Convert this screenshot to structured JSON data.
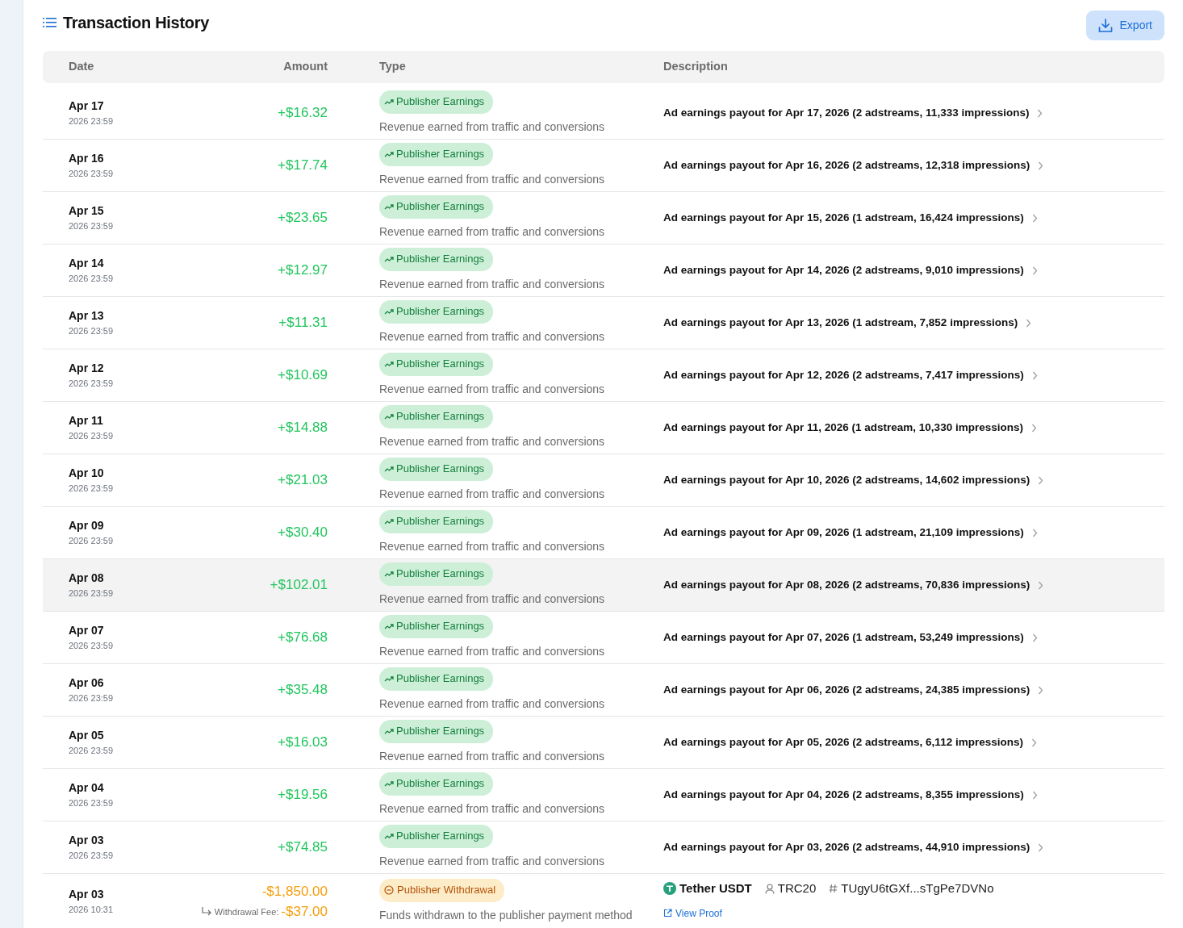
{
  "title": "Transaction History",
  "export_button": "Export",
  "columns": [
    "Date",
    "Amount",
    "Type",
    "Description"
  ],
  "rows": [
    {
      "kind": "earning",
      "highlighted": false,
      "date": "Apr 17",
      "time": "2026 23:59",
      "amount": "+$16.32",
      "type": "Publisher Earnings",
      "type_note": "Revenue earned from traffic and conversions",
      "description": "Ad earnings payout for Apr 17, 2026 (2 adstreams, 11,333 impressions)"
    },
    {
      "kind": "earning",
      "highlighted": false,
      "date": "Apr 16",
      "time": "2026 23:59",
      "amount": "+$17.74",
      "type": "Publisher Earnings",
      "type_note": "Revenue earned from traffic and conversions",
      "description": "Ad earnings payout for Apr 16, 2026 (2 adstreams, 12,318 impressions)"
    },
    {
      "kind": "earning",
      "highlighted": false,
      "date": "Apr 15",
      "time": "2026 23:59",
      "amount": "+$23.65",
      "type": "Publisher Earnings",
      "type_note": "Revenue earned from traffic and conversions",
      "description": "Ad earnings payout for Apr 15, 2026 (1 adstream, 16,424 impressions)"
    },
    {
      "kind": "earning",
      "highlighted": false,
      "date": "Apr 14",
      "time": "2026 23:59",
      "amount": "+$12.97",
      "type": "Publisher Earnings",
      "type_note": "Revenue earned from traffic and conversions",
      "description": "Ad earnings payout for Apr 14, 2026 (2 adstreams, 9,010 impressions)"
    },
    {
      "kind": "earning",
      "highlighted": false,
      "date": "Apr 13",
      "time": "2026 23:59",
      "amount": "+$11.31",
      "type": "Publisher Earnings",
      "type_note": "Revenue earned from traffic and conversions",
      "description": "Ad earnings payout for Apr 13, 2026 (1 adstream, 7,852 impressions)"
    },
    {
      "kind": "earning",
      "highlighted": false,
      "date": "Apr 12",
      "time": "2026 23:59",
      "amount": "+$10.69",
      "type": "Publisher Earnings",
      "type_note": "Revenue earned from traffic and conversions",
      "description": "Ad earnings payout for Apr 12, 2026 (2 adstreams, 7,417 impressions)"
    },
    {
      "kind": "earning",
      "highlighted": false,
      "date": "Apr 11",
      "time": "2026 23:59",
      "amount": "+$14.88",
      "type": "Publisher Earnings",
      "type_note": "Revenue earned from traffic and conversions",
      "description": "Ad earnings payout for Apr 11, 2026 (1 adstream, 10,330 impressions)"
    },
    {
      "kind": "earning",
      "highlighted": false,
      "date": "Apr 10",
      "time": "2026 23:59",
      "amount": "+$21.03",
      "type": "Publisher Earnings",
      "type_note": "Revenue earned from traffic and conversions",
      "description": "Ad earnings payout for Apr 10, 2026 (2 adstreams, 14,602 impressions)"
    },
    {
      "kind": "earning",
      "highlighted": false,
      "date": "Apr 09",
      "time": "2026 23:59",
      "amount": "+$30.40",
      "type": "Publisher Earnings",
      "type_note": "Revenue earned from traffic and conversions",
      "description": "Ad earnings payout for Apr 09, 2026 (1 adstream, 21,109 impressions)"
    },
    {
      "kind": "earning",
      "highlighted": true,
      "date": "Apr 08",
      "time": "2026 23:59",
      "amount": "+$102.01",
      "type": "Publisher Earnings",
      "type_note": "Revenue earned from traffic and conversions",
      "description": "Ad earnings payout for Apr 08, 2026 (2 adstreams, 70,836 impressions)"
    },
    {
      "kind": "earning",
      "highlighted": false,
      "date": "Apr 07",
      "time": "2026 23:59",
      "amount": "+$76.68",
      "type": "Publisher Earnings",
      "type_note": "Revenue earned from traffic and conversions",
      "description": "Ad earnings payout for Apr 07, 2026 (1 adstream, 53,249 impressions)"
    },
    {
      "kind": "earning",
      "highlighted": false,
      "date": "Apr 06",
      "time": "2026 23:59",
      "amount": "+$35.48",
      "type": "Publisher Earnings",
      "type_note": "Revenue earned from traffic and conversions",
      "description": "Ad earnings payout for Apr 06, 2026 (2 adstreams, 24,385 impressions)"
    },
    {
      "kind": "earning",
      "highlighted": false,
      "date": "Apr 05",
      "time": "2026 23:59",
      "amount": "+$16.03",
      "type": "Publisher Earnings",
      "type_note": "Revenue earned from traffic and conversions",
      "description": "Ad earnings payout for Apr 05, 2026 (2 adstreams, 6,112 impressions)"
    },
    {
      "kind": "earning",
      "highlighted": false,
      "date": "Apr 04",
      "time": "2026 23:59",
      "amount": "+$19.56",
      "type": "Publisher Earnings",
      "type_note": "Revenue earned from traffic and conversions",
      "description": "Ad earnings payout for Apr 04, 2026 (2 adstreams, 8,355 impressions)"
    },
    {
      "kind": "earning",
      "highlighted": false,
      "date": "Apr 03",
      "time": "2026 23:59",
      "amount": "+$74.85",
      "type": "Publisher Earnings",
      "type_note": "Revenue earned from traffic and conversions",
      "description": "Ad earnings payout for Apr 03, 2026 (2 adstreams, 44,910 impressions)"
    },
    {
      "kind": "withdrawal",
      "highlighted": false,
      "date": "Apr 03",
      "time": "2026 10:31",
      "amount": "-$1,850.00",
      "fee_label": "Withdrawal Fee:",
      "fee": "-$37.00",
      "type": "Publisher Withdrawal",
      "type_note": "Funds withdrawn to the publisher payment method",
      "method": "Tether USDT",
      "network": "TRC20",
      "address": "TUgyU6tGXf...sTgPe7DVNo",
      "proof_link": "View Proof"
    }
  ]
}
